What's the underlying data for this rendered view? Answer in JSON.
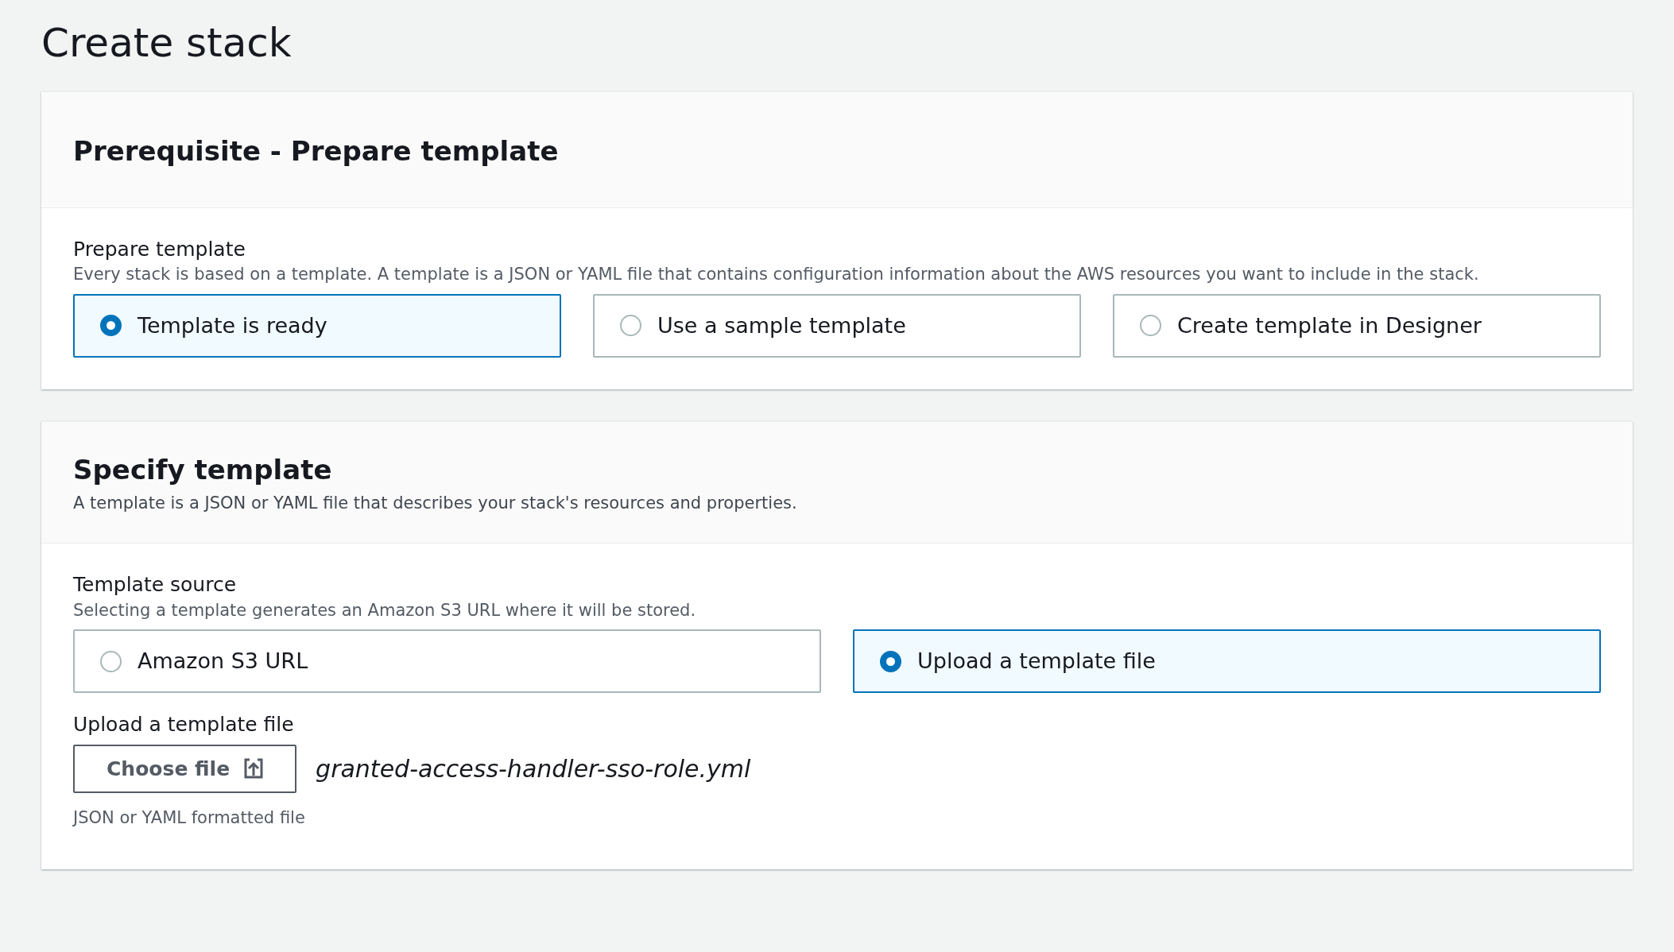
{
  "page_title": "Create stack",
  "prepare_section": {
    "title": "Prerequisite - Prepare template",
    "field": {
      "label": "Prepare template",
      "description": "Every stack is based on a template. A template is a JSON or YAML file that contains configuration information about the AWS resources you want to include in the stack.",
      "options": [
        {
          "label": "Template is ready",
          "selected": true
        },
        {
          "label": "Use a sample template",
          "selected": false
        },
        {
          "label": "Create template in Designer",
          "selected": false
        }
      ]
    }
  },
  "specify_section": {
    "title": "Specify template",
    "description": "A template is a JSON or YAML file that describes your stack's resources and properties.",
    "field": {
      "label": "Template source",
      "description": "Selecting a template generates an Amazon S3 URL where it will be stored.",
      "options": [
        {
          "label": "Amazon S3 URL",
          "selected": false
        },
        {
          "label": "Upload a template file",
          "selected": true
        }
      ]
    },
    "upload": {
      "label": "Upload a template file",
      "button": "Choose file",
      "file_name": "granted-access-handler-sso-role.yml",
      "hint": "JSON or YAML formatted file"
    }
  }
}
